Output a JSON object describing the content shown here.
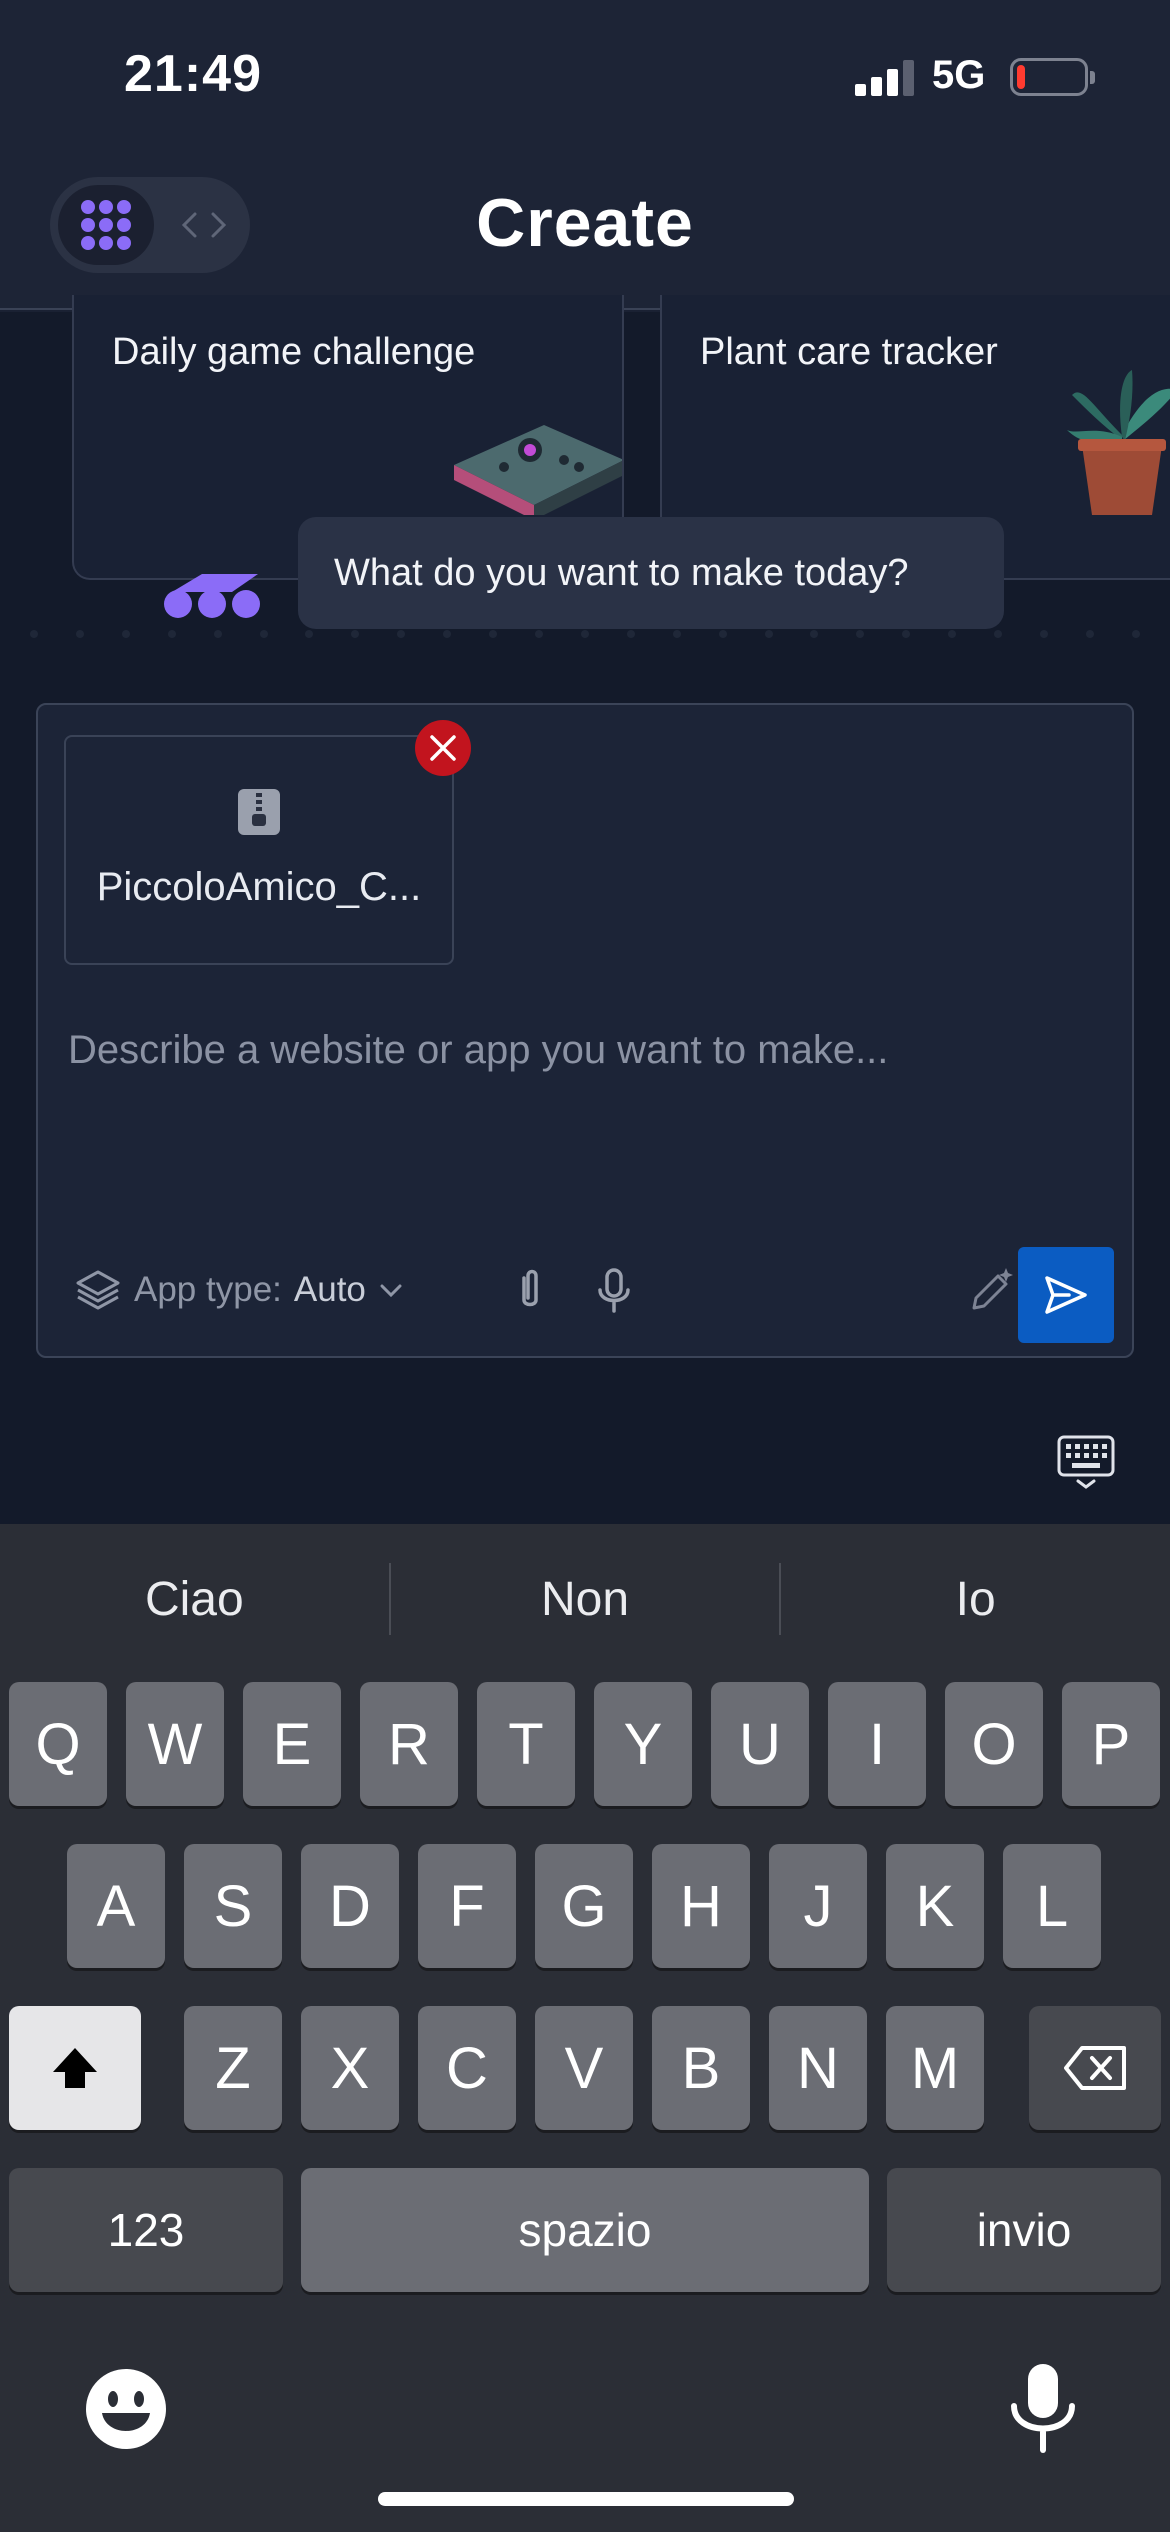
{
  "status_bar": {
    "time": "21:49",
    "network": "5G",
    "battery_level_fraction": 0.12,
    "battery_color": "#ff3b30"
  },
  "header": {
    "title": "Create",
    "toggle_active_icon": "grid-dots-icon",
    "toggle_inactive_icon": "code-brackets-icon"
  },
  "suggestions": [
    {
      "title": "Daily game challenge"
    },
    {
      "title": "Plant care tracker"
    }
  ],
  "assistant": {
    "message": "What do you want to make today?",
    "accent_color": "#8b6cf7"
  },
  "composer": {
    "attachment": {
      "file_name": "PiccoloAmico_C...",
      "icon": "zip-file-icon"
    },
    "input": {
      "placeholder": "Describe a website or app you want to make...",
      "value": ""
    },
    "app_type_label": "App type:",
    "app_type_value": "Auto",
    "send_color": "#0b5cc2"
  },
  "keyboard": {
    "predictions": [
      "Ciao",
      "Non",
      "Io"
    ],
    "row1": [
      "Q",
      "W",
      "E",
      "R",
      "T",
      "Y",
      "U",
      "I",
      "O",
      "P"
    ],
    "row2": [
      "A",
      "S",
      "D",
      "F",
      "G",
      "H",
      "J",
      "K",
      "L"
    ],
    "row3": [
      "Z",
      "X",
      "C",
      "V",
      "B",
      "N",
      "M"
    ],
    "numbers_label": "123",
    "space_label": "spazio",
    "return_label": "invio"
  }
}
